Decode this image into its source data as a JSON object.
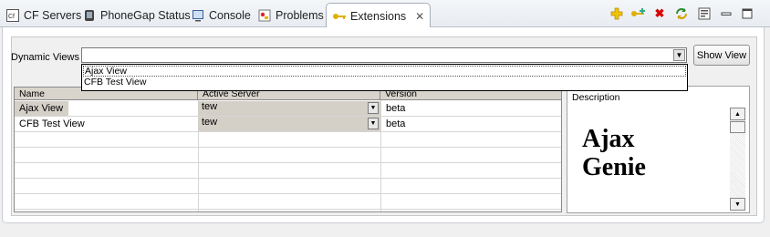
{
  "tabs": [
    {
      "label": "CF Servers",
      "icon": "cf-servers-icon"
    },
    {
      "label": "PhoneGap Status",
      "icon": "phonegap-icon"
    },
    {
      "label": "Console",
      "icon": "console-icon"
    },
    {
      "label": "Problems",
      "icon": "problems-icon"
    },
    {
      "label": "Extensions",
      "icon": "key-icon",
      "active": true
    }
  ],
  "toolbar": {
    "icons": [
      "add-icon",
      "key-add-icon",
      "delete-icon",
      "refresh-icon",
      "properties-icon",
      "minimize-icon",
      "maximize-icon"
    ]
  },
  "dynamic_views": {
    "label": "Dynamic Views",
    "value": "",
    "show_button": "Show View",
    "options": [
      "Ajax View",
      "CFB Test View"
    ]
  },
  "table": {
    "columns": [
      "Name",
      "Active Server",
      "Version"
    ],
    "rows": [
      {
        "name": "Ajax View",
        "server": "tew",
        "version": "beta"
      },
      {
        "name": "CFB Test View",
        "server": "tew",
        "version": "beta"
      }
    ]
  },
  "description": {
    "title": "Description",
    "body_line1": "Ajax",
    "body_line2": "Genie"
  },
  "colors": {
    "selection_gray": "#d4d0c8",
    "accent_yellow": "#f3c400",
    "delete_red": "#d90000"
  }
}
